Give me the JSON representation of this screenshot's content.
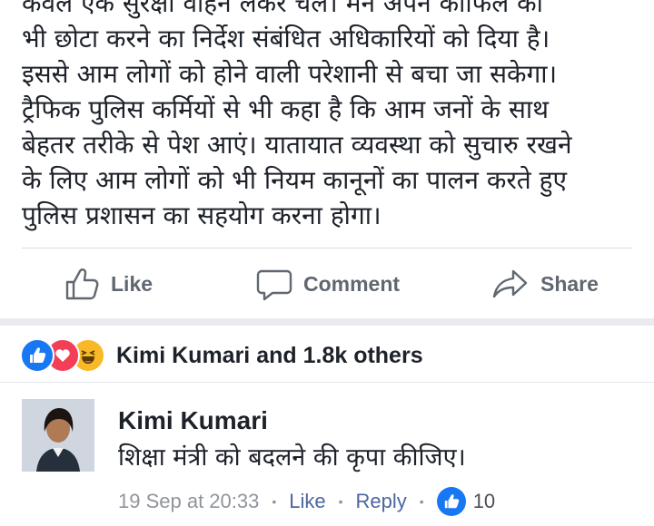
{
  "post": {
    "lines": [
      "केवल एक सुरक्षा वाहन लेकर चलें। मैंने अपने काफिले को",
      "भी छोटा करने का निर्देश संबंधित अधिकारियों को दिया है।",
      "इससे आम लोगों को होने वाली परेशानी से बचा जा सकेगा।",
      "ट्रैफिक पुलिस कर्मियों से भी कहा है कि आम जनों के साथ",
      "बेहतर तरीके से पेश आएं। यातायात व्यवस्था को सुचारु रखने",
      "के लिए आम लोगों को भी नियम कानूनों का पालन करते हुए",
      "पुलिस प्रशासन का सहयोग करना होगा।"
    ]
  },
  "actions": {
    "like_label": "Like",
    "comment_label": "Comment",
    "share_label": "Share"
  },
  "reactions": {
    "summary": "Kimi Kumari and 1.8k others",
    "icons": [
      "like-icon",
      "love-icon",
      "haha-icon"
    ],
    "colors": {
      "like": "#1877f2",
      "love": "#f33e58",
      "haha": "#f7b928"
    }
  },
  "comment": {
    "author": "Kimi Kumari",
    "text": "शिक्षा मंत्री को बदलने की कृपा कीजिए।",
    "time": "19 Sep at 20:33",
    "like_label": "Like",
    "reply_label": "Reply",
    "like_count": "10"
  }
}
